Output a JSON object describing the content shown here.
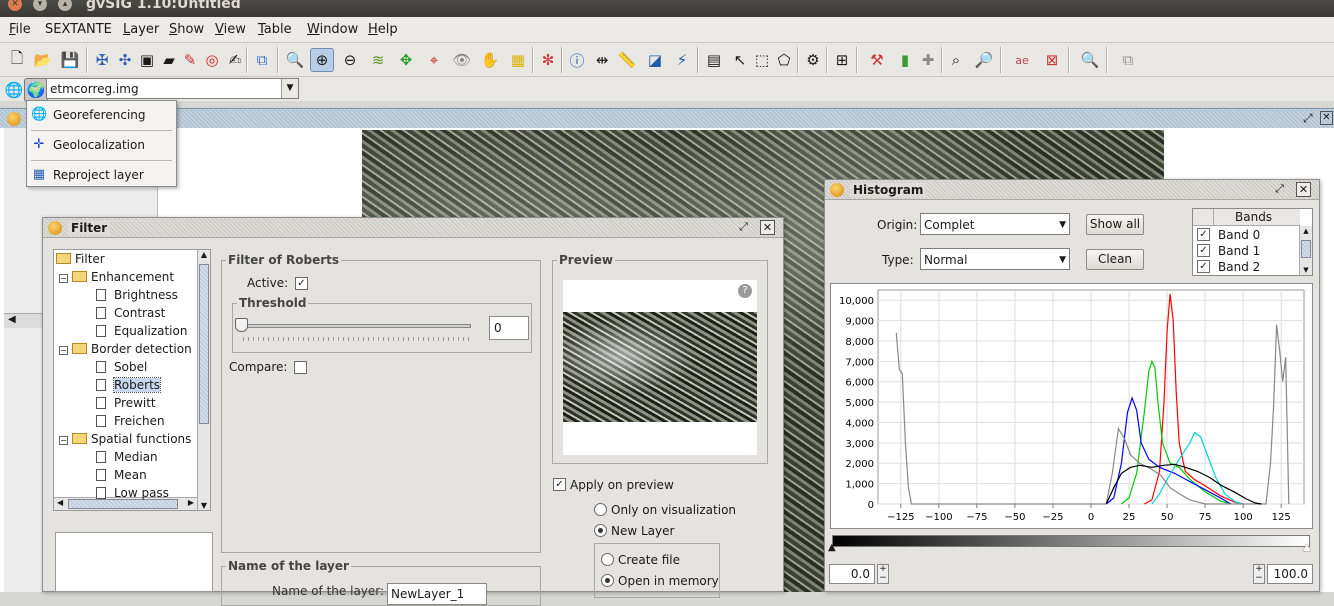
{
  "window": {
    "title": "gvSIG 1.10:Untitled"
  },
  "menu": [
    "File",
    "SEXTANTE",
    "Layer",
    "Show",
    "View",
    "Table",
    "Window",
    "Help"
  ],
  "menu_mnemonics": [
    "F",
    "",
    "L",
    "S",
    "V",
    "T",
    "W",
    "H"
  ],
  "layer_selector": {
    "value": "etmcorreg.img"
  },
  "geo_menu": {
    "items": [
      {
        "label": "Georeferencing",
        "icon": "globe-icon"
      },
      {
        "label": "Geolocalization",
        "icon": "crosshair-icon"
      },
      {
        "label": "Reproject layer",
        "icon": "grid-globe-icon"
      }
    ]
  },
  "filter": {
    "title": "Filter",
    "tree": [
      {
        "label": "Filter",
        "level": 0,
        "kind": "folder"
      },
      {
        "label": "Enhancement",
        "level": 1,
        "kind": "folder"
      },
      {
        "label": "Brightness",
        "level": 2,
        "kind": "doc"
      },
      {
        "label": "Contrast",
        "level": 2,
        "kind": "doc"
      },
      {
        "label": "Equalization",
        "level": 2,
        "kind": "doc"
      },
      {
        "label": "Border detection",
        "level": 1,
        "kind": "folder"
      },
      {
        "label": "Sobel",
        "level": 2,
        "kind": "doc"
      },
      {
        "label": "Roberts",
        "level": 2,
        "kind": "doc",
        "selected": true
      },
      {
        "label": "Prewitt",
        "level": 2,
        "kind": "doc"
      },
      {
        "label": "Freichen",
        "level": 2,
        "kind": "doc"
      },
      {
        "label": "Spatial functions",
        "level": 1,
        "kind": "folder"
      },
      {
        "label": "Median",
        "level": 2,
        "kind": "doc"
      },
      {
        "label": "Mean",
        "level": 2,
        "kind": "doc"
      },
      {
        "label": "Low pass",
        "level": 2,
        "kind": "doc"
      }
    ],
    "group_title": "Filter of Roberts",
    "active_label": "Active:",
    "active_checked": true,
    "threshold_title": "Threshold",
    "threshold_value": "0",
    "compare_label": "Compare:",
    "compare_checked": false,
    "preview_title": "Preview",
    "apply_preview_label": "Apply on preview",
    "apply_preview_checked": true,
    "only_vis_label": "Only on visualization",
    "new_layer_label": "New Layer",
    "new_layer_selected": true,
    "create_file_label": "Create file",
    "open_memory_label": "Open in memory",
    "open_memory_selected": true,
    "name_layer_title": "Name of the layer",
    "name_layer_partial": "Name of the layer:",
    "name_layer_value": "NewLayer_1"
  },
  "histogram": {
    "title": "Histogram",
    "origin_label": "Origin:",
    "origin_value": "Complet",
    "type_label": "Type:",
    "type_value": "Normal",
    "show_all_label": "Show all",
    "clean_label": "Clean",
    "bands_header": "Bands",
    "bands": [
      {
        "label": "Band 0",
        "checked": true
      },
      {
        "label": "Band 1",
        "checked": true
      },
      {
        "label": "Band 2",
        "checked": true
      }
    ],
    "min_value": "0.0",
    "max_value": "100.0",
    "colors": {
      "band0": "#ff0000",
      "band1": "#00dd00",
      "band2": "#0000ff",
      "rgb": "#00e5e5",
      "gray": "#888888",
      "black": "#000000"
    }
  },
  "chart_data": {
    "type": "line",
    "title": "",
    "xlabel": "",
    "ylabel": "",
    "xlim": [
      -140,
      140
    ],
    "ylim": [
      0,
      10500
    ],
    "x_ticks": [
      -125,
      -100,
      -75,
      -50,
      -25,
      0,
      25,
      50,
      75,
      100,
      125
    ],
    "y_ticks": [
      0,
      1000,
      2000,
      3000,
      4000,
      5000,
      6000,
      7000,
      8000,
      9000,
      10000
    ],
    "y_tick_labels": [
      "0",
      "1,000",
      "2,000",
      "3,000",
      "4,000",
      "5,000",
      "6,000",
      "7,000",
      "8,000",
      "9,000",
      "10,000"
    ],
    "grid": true,
    "series": [
      {
        "color": "#ff0000",
        "points": [
          [
            35,
            0
          ],
          [
            40,
            200
          ],
          [
            45,
            1600
          ],
          [
            48,
            5000
          ],
          [
            50,
            8500
          ],
          [
            52,
            10300
          ],
          [
            54,
            9000
          ],
          [
            56,
            5500
          ],
          [
            58,
            3000
          ],
          [
            62,
            1600
          ],
          [
            68,
            1200
          ],
          [
            75,
            900
          ],
          [
            85,
            400
          ],
          [
            95,
            80
          ],
          [
            100,
            0
          ]
        ]
      },
      {
        "color": "#00cc00",
        "points": [
          [
            20,
            0
          ],
          [
            25,
            300
          ],
          [
            30,
            1500
          ],
          [
            35,
            4500
          ],
          [
            38,
            6500
          ],
          [
            40,
            7000
          ],
          [
            42,
            6700
          ],
          [
            44,
            5000
          ],
          [
            47,
            3000
          ],
          [
            52,
            2000
          ],
          [
            58,
            1800
          ],
          [
            65,
            1200
          ],
          [
            75,
            600
          ],
          [
            85,
            150
          ],
          [
            92,
            0
          ]
        ]
      },
      {
        "color": "#0000ff",
        "points": [
          [
            10,
            0
          ],
          [
            15,
            300
          ],
          [
            20,
            2000
          ],
          [
            24,
            4500
          ],
          [
            27,
            5200
          ],
          [
            30,
            4600
          ],
          [
            33,
            3000
          ],
          [
            38,
            2200
          ],
          [
            45,
            1800
          ],
          [
            55,
            1500
          ],
          [
            65,
            1100
          ],
          [
            75,
            700
          ],
          [
            85,
            300
          ],
          [
            92,
            0
          ]
        ]
      },
      {
        "color": "#00d5d5",
        "points": [
          [
            40,
            0
          ],
          [
            45,
            500
          ],
          [
            50,
            1200
          ],
          [
            58,
            2200
          ],
          [
            65,
            3000
          ],
          [
            68,
            3500
          ],
          [
            72,
            3300
          ],
          [
            76,
            2500
          ],
          [
            82,
            1300
          ],
          [
            88,
            500
          ],
          [
            95,
            100
          ],
          [
            100,
            0
          ]
        ]
      },
      {
        "color": "#888888",
        "points": [
          [
            -128,
            8400
          ],
          [
            -126,
            6600
          ],
          [
            -124,
            6400
          ],
          [
            -122,
            3000
          ],
          [
            -120,
            800
          ],
          [
            -118,
            0
          ],
          [
            10,
            0
          ],
          [
            14,
            1500
          ],
          [
            18,
            3700
          ],
          [
            22,
            3200
          ],
          [
            26,
            2400
          ],
          [
            32,
            2000
          ],
          [
            40,
            1700
          ],
          [
            46,
            1400
          ],
          [
            52,
            800
          ],
          [
            58,
            500
          ],
          [
            65,
            200
          ],
          [
            75,
            0
          ],
          [
            115,
            0
          ],
          [
            118,
            2000
          ],
          [
            120,
            4800
          ],
          [
            122,
            8800
          ],
          [
            124,
            7500
          ],
          [
            126,
            6000
          ],
          [
            128,
            7200
          ],
          [
            130,
            0
          ]
        ]
      },
      {
        "color": "#000000",
        "points": [
          [
            10,
            0
          ],
          [
            15,
            800
          ],
          [
            20,
            1500
          ],
          [
            26,
            1800
          ],
          [
            32,
            1900
          ],
          [
            40,
            1800
          ],
          [
            48,
            1900
          ],
          [
            55,
            1950
          ],
          [
            62,
            1800
          ],
          [
            70,
            1600
          ],
          [
            78,
            1300
          ],
          [
            86,
            900
          ],
          [
            94,
            600
          ],
          [
            102,
            250
          ],
          [
            108,
            50
          ],
          [
            112,
            0
          ]
        ]
      }
    ]
  }
}
